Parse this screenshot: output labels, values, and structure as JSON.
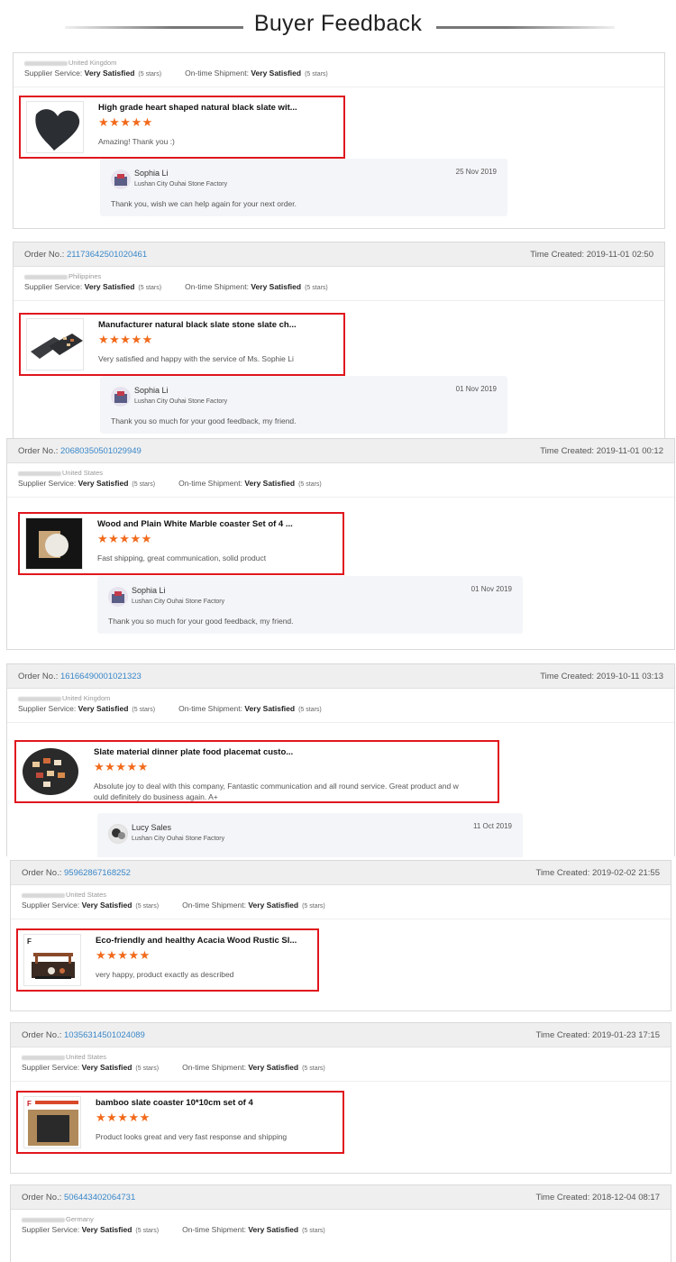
{
  "page_title": "Buyer Feedback",
  "labels": {
    "order_no": "Order No.:",
    "time_created": "Time Created:",
    "supplier_service": "Supplier Service:",
    "ontime_shipment": "On-time Shipment:",
    "rating_value": "Very Satisfied",
    "rating_stars": "(5 stars)"
  },
  "star_glyphs": "★★★★★",
  "accent_colors": {
    "star": "#f26a1b",
    "highlight_border": "#e0161d",
    "order_link": "#3a87c8"
  },
  "reviews": [
    {
      "order_no": "",
      "time_created": "",
      "country": "United Kingdom",
      "product": "High grade heart shaped natural black slate wit...",
      "stars": 5,
      "comment": "Amazing! Thank you :)",
      "reply": {
        "name": "Sophia Li",
        "company": "Lushan City Ouhai Stone Factory",
        "date": "25 Nov 2019",
        "text": "Thank you, wish we can help again for your next order."
      }
    },
    {
      "order_no": "21173642501020461",
      "time_created": "2019-11-01 02:50",
      "country": "Philippines",
      "product": "Manufacturer natural black slate stone slate ch...",
      "stars": 5,
      "comment": "Very satisfied and happy with the service of Ms. Sophie Li",
      "reply": {
        "name": "Sophia Li",
        "company": "Lushan City Ouhai Stone Factory",
        "date": "01 Nov 2019",
        "text": "Thank you so much for your good feedback, my friend."
      }
    },
    {
      "order_no": "20680350501029949",
      "time_created": "2019-11-01 00:12",
      "country": "United States",
      "product": "Wood and Plain White Marble coaster Set of 4 ...",
      "stars": 5,
      "comment": "Fast shipping, great communication, solid product",
      "reply": {
        "name": "Sophia Li",
        "company": "Lushan City Ouhai Stone Factory",
        "date": "01 Nov 2019",
        "text": "Thank you so much for your good feedback, my friend."
      }
    },
    {
      "order_no": "16166490001021323",
      "time_created": "2019-10-11 03:13",
      "country": "United Kingdom",
      "product": "Slate material dinner plate food placemat custo...",
      "stars": 5,
      "comment_line1": "Absolute joy to deal with this company, Fantastic communication and all round service. Great product and w",
      "comment_line2": "ould definitely do business again. A+",
      "reply": {
        "name": "Lucy Sales",
        "company": "Lushan City Ouhai Stone Factory",
        "date": "11 Oct 2019",
        "text": ""
      }
    },
    {
      "order_no": "95962867168252",
      "time_created": "2019-02-02 21:55",
      "country": "United States",
      "product": "Eco-friendly and healthy Acacia Wood Rustic Sl...",
      "stars": 5,
      "comment": "very happy, product exactly as described"
    },
    {
      "order_no": "10356314501024089",
      "time_created": "2019-01-23 17:15",
      "country": "United States",
      "product": "bamboo slate coaster 10*10cm set of 4",
      "stars": 5,
      "comment": "Product looks great and very fast response and shipping"
    },
    {
      "order_no": "506443402064731",
      "time_created": "2018-12-04 08:17",
      "country": "Germany"
    }
  ]
}
